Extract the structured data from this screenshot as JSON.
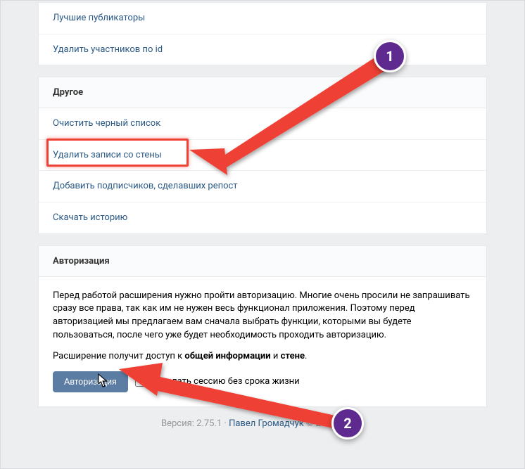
{
  "top_panel": {
    "items": [
      "Лучшие публикаторы",
      "Удалить участников по id"
    ]
  },
  "other_section": {
    "title": "Другое",
    "items": [
      "Очистить черный список",
      "Удалить записи со стены",
      "Добавить подписчиков, сделавших репост",
      "Скачать историю"
    ]
  },
  "auth_section": {
    "title": "Авторизация",
    "desc1_before": "Перед работой расширения нужно пройти авторизацию. Многие очень просили не запрашивать сразу все права, так как им не нужен весь функционал приложения. Поэтому перед авторизацией мы предлагаем вам сначала выбрать функции, которыми вы будете пользоваться, после чего уже будет необходимость проходить авторизацию.",
    "desc2_prefix": "Расширение получит доступ к ",
    "desc2_b1": "общей информации",
    "desc2_and": " и ",
    "desc2_b2": "стене",
    "desc2_suffix": ".",
    "button_label": "Авторизация",
    "checkbox_label": "- сделать сессию без срока жизни"
  },
  "footer": {
    "prefix": "Версия: 2.75.1 · ",
    "author": "Павел Громадчук",
    "suffix": " © 2016 - 2018"
  },
  "annotations": {
    "marker1": "1",
    "marker2": "2"
  }
}
